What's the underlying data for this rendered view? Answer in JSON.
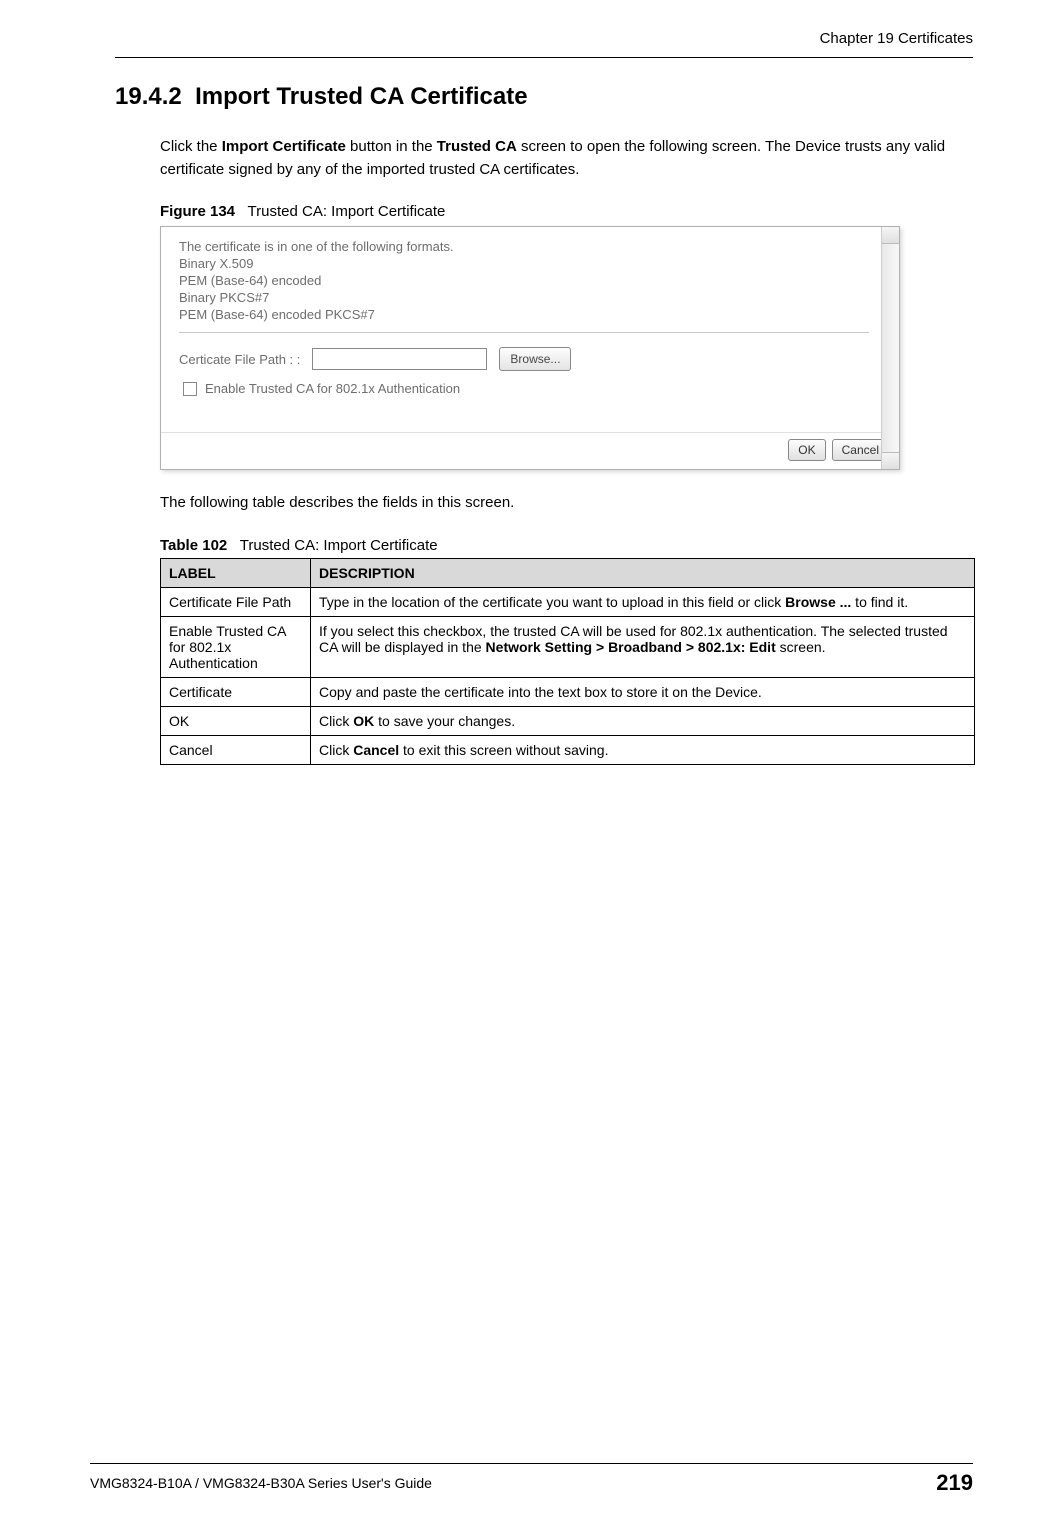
{
  "header": {
    "chapter": "Chapter 19 Certificates"
  },
  "section": {
    "number": "19.4.2",
    "title": "Import Trusted CA Certificate"
  },
  "intro": {
    "pre": "Click the ",
    "b1": "Import Certificate",
    "mid1": " button in the ",
    "b2": "Trusted CA",
    "post": " screen to open the following screen. The Device trusts any valid certificate signed by any of the imported trusted CA certificates."
  },
  "figure": {
    "caption_label": "Figure 134",
    "caption_text": "Trusted CA: Import Certificate",
    "formats_intro": "The certificate is in one of the following formats.",
    "formats": [
      "Binary X.509",
      "PEM (Base-64) encoded",
      "Binary PKCS#7",
      "PEM (Base-64) encoded PKCS#7"
    ],
    "file_path_label": "Certicate File Path : :",
    "browse_label": "Browse...",
    "checkbox_label": "Enable Trusted CA for 802.1x Authentication",
    "ok_label": "OK",
    "cancel_label": "Cancel"
  },
  "table_intro": "The following table describes the fields in this screen.",
  "table": {
    "caption_label": "Table 102",
    "caption_text": "Trusted CA: Import Certificate",
    "head_label": "LABEL",
    "head_desc": "DESCRIPTION",
    "rows": [
      {
        "label": "Certificate File Path",
        "desc_pre": "Type in the location of the certificate you want to upload in this field or click ",
        "desc_b1": "Browse ...",
        "desc_post": " to find it."
      },
      {
        "label": "Enable Trusted CA for 802.1x Authentication",
        "desc_pre": "If you select this checkbox, the trusted CA will be used for 802.1x authentication. The selected trusted CA will be displayed in the ",
        "desc_b1": "Network Setting > Broadband > 802.1x: Edit",
        "desc_post": " screen."
      },
      {
        "label": "Certificate",
        "desc_pre": "Copy and paste the certificate into the text box to store it on the Device.",
        "desc_b1": "",
        "desc_post": ""
      },
      {
        "label": "OK",
        "desc_pre": "Click ",
        "desc_b1": "OK",
        "desc_post": " to save your changes."
      },
      {
        "label": "Cancel",
        "desc_pre": "Click ",
        "desc_b1": "Cancel",
        "desc_post": " to exit this screen without saving."
      }
    ]
  },
  "footer": {
    "guide": "VMG8324-B10A / VMG8324-B30A Series User's Guide",
    "page": "219"
  }
}
